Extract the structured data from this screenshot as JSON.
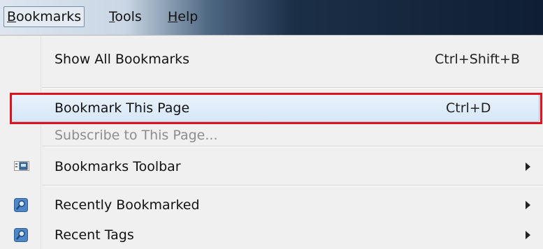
{
  "menubar": {
    "items": [
      {
        "label": "Bookmarks",
        "underline": "B",
        "rest": "ookmarks"
      },
      {
        "label": "Tools",
        "underline": "T",
        "rest": "ools"
      },
      {
        "label": "Help",
        "underline": "H",
        "rest": "elp"
      }
    ]
  },
  "menu": {
    "show_all": {
      "label": "Show All Bookmarks",
      "shortcut": "Ctrl+Shift+B"
    },
    "bookmark_page": {
      "label": "Bookmark This Page",
      "shortcut": "Ctrl+D"
    },
    "subscribe": {
      "label": "Subscribe to This Page..."
    },
    "toolbar": {
      "label": "Bookmarks Toolbar",
      "icon": "bookmarks-toolbar-icon"
    },
    "recent_bookmarked": {
      "label": "Recently Bookmarked",
      "icon": "smart-folder-icon"
    },
    "recent_tags": {
      "label": "Recent Tags",
      "icon": "smart-folder-icon"
    }
  },
  "colors": {
    "highlight_outline": "#e0121b",
    "selection": "#d6e7f7"
  }
}
